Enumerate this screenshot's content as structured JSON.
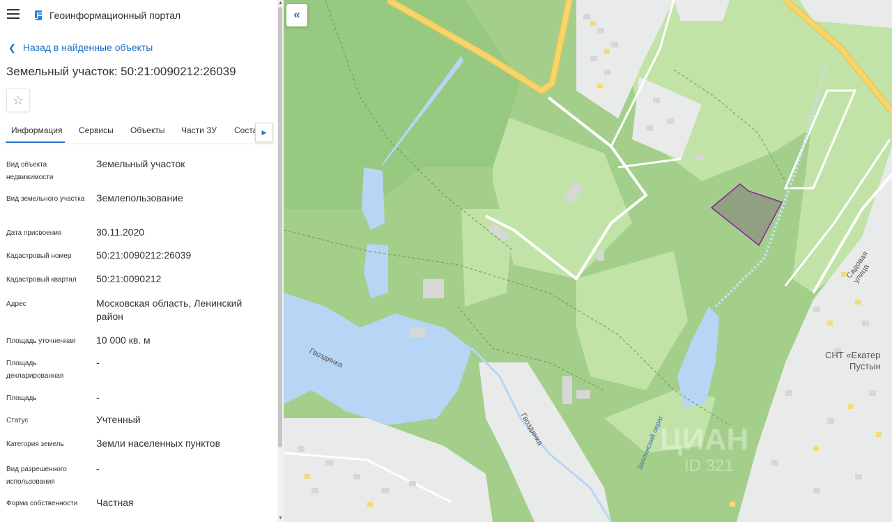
{
  "header": {
    "title": "Геоинформационный портал",
    "menu_icon": "hamburger-icon",
    "logo_icon": "layers-logo-icon"
  },
  "back_link": {
    "label": "Назад в найденные объекты"
  },
  "object": {
    "title": "Земельный участок: 50:21:0090212:26039"
  },
  "tabs": [
    {
      "label": "Информация",
      "active": true
    },
    {
      "label": "Сервисы"
    },
    {
      "label": "Объекты"
    },
    {
      "label": "Части ЗУ"
    },
    {
      "label": "Соста"
    }
  ],
  "details": [
    {
      "label": "Вид объекта недвижимости",
      "value": "Земельный участок"
    },
    {
      "label": "Вид земельного участка",
      "value": "Землепользование"
    },
    {
      "label": "Дата присвоения",
      "value": "30.11.2020"
    },
    {
      "label": "Кадастровый номер",
      "value": "50:21:0090212:26039"
    },
    {
      "label": "Кадастровый квартал",
      "value": "50:21:0090212"
    },
    {
      "label": "Адрес",
      "value": "Московская область, Ленинский район"
    },
    {
      "label": "Площадь уточненная",
      "value": "10 000 кв. м"
    },
    {
      "label": "Площадь декларированная",
      "value": "-"
    },
    {
      "label": "Площадь",
      "value": "-"
    },
    {
      "label": "Статус",
      "value": "Учтенный"
    },
    {
      "label": "Категория земель",
      "value": "Земли населенных пунктов"
    },
    {
      "label": "Вид разрешенного использования",
      "value": "-"
    },
    {
      "label": "Форма собственности",
      "value": "Частная"
    }
  ],
  "map": {
    "labels": {
      "lake_name": "Гвоздянка",
      "river_name": "Гвоздянка",
      "ravine_name": "Заплинский овраг",
      "street_name": "Садовая улица",
      "snt_line1": "СНТ «Екатер",
      "snt_line2": "Пустын",
      "watermark_name": "ЦИАН",
      "watermark_id": "ID 321"
    },
    "colors": {
      "forest": "#a3cf8a",
      "meadow": "#c2e3a7",
      "water": "#b7d6f5",
      "parcel": "#8f9a7e",
      "parcel_border": "#8a1fa0",
      "road": "#f6d56a"
    }
  }
}
